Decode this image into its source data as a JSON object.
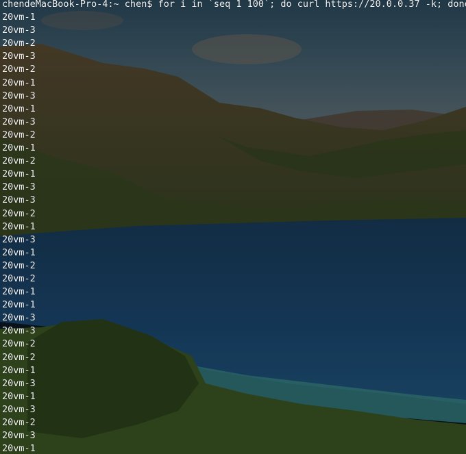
{
  "terminal": {
    "prompt": "chendeMacBook-Pro-4:~ chen$ for i in `seq 1 100`; do curl https://20.0.0.37 -k; done",
    "output": [
      "20vm-1",
      "20vm-3",
      "20vm-2",
      "20vm-3",
      "20vm-2",
      "20vm-1",
      "20vm-3",
      "20vm-1",
      "20vm-3",
      "20vm-2",
      "20vm-1",
      "20vm-2",
      "20vm-1",
      "20vm-3",
      "20vm-3",
      "20vm-2",
      "20vm-1",
      "20vm-3",
      "20vm-1",
      "20vm-2",
      "20vm-2",
      "20vm-1",
      "20vm-1",
      "20vm-3",
      "20vm-3",
      "20vm-2",
      "20vm-2",
      "20vm-1",
      "20vm-3",
      "20vm-1",
      "20vm-3",
      "20vm-2",
      "20vm-3",
      "20vm-1"
    ]
  },
  "colors": {
    "text": "#f2f2f2",
    "sky": "#3d5b6d",
    "lake": "#1d4a70",
    "shallows": "#3a8a8c",
    "hills": "#5a4a2c",
    "vegetation": "#344a24"
  }
}
